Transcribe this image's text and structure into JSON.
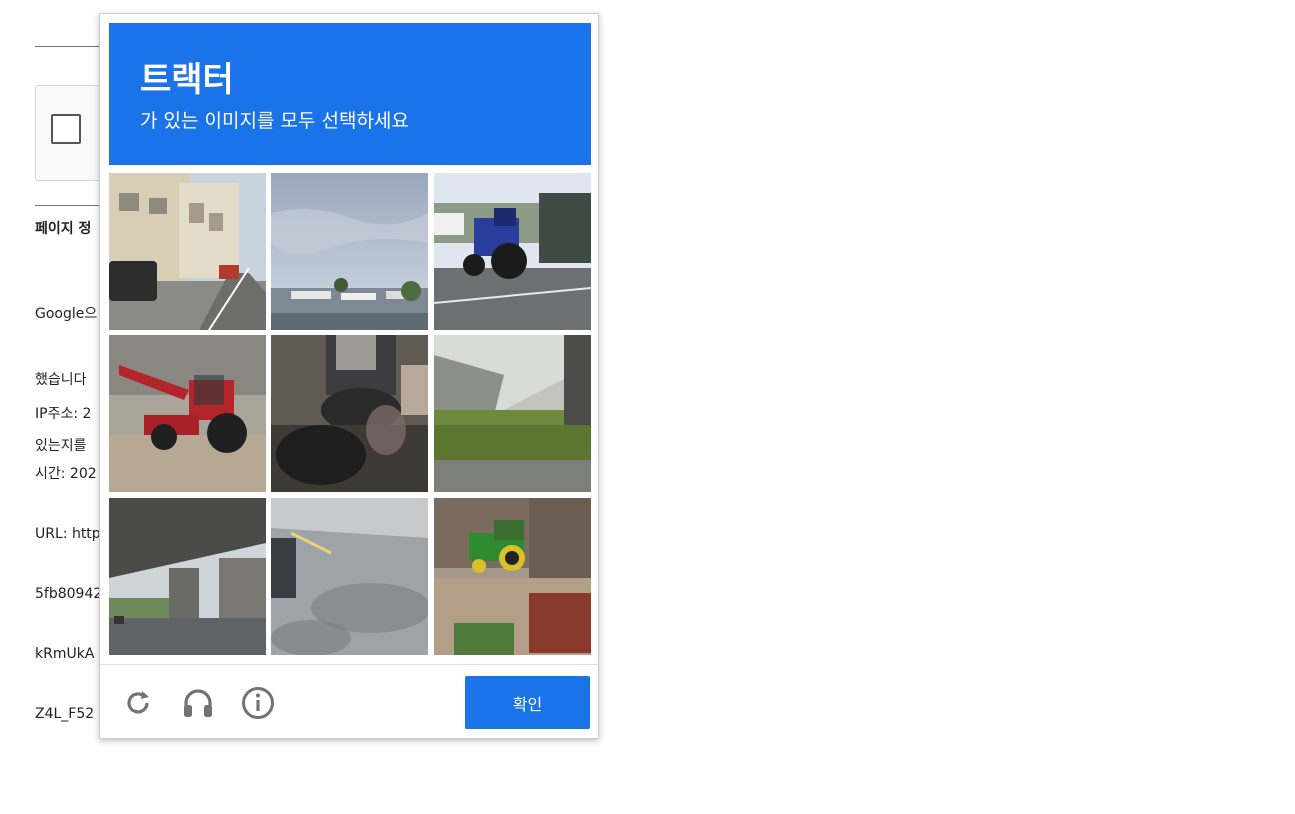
{
  "background_page": {
    "section_title": "페이지 정",
    "paragraph_lines": [
      "Google으",
      "했습니다",
      "있는지를"
    ],
    "info_lines": [
      "IP주소: 2",
      "시간: 202",
      "URL: http",
      "5fb80942",
      "kRmUkA",
      "Z4L_F52"
    ]
  },
  "challenge": {
    "keyword": "트랙터",
    "instruction": "가 있는 이미지를 모두 선택하세요",
    "tiles": [
      {
        "scene": "street with buildings and parked van",
        "selected": false
      },
      {
        "scene": "harbor under cloudy sky",
        "selected": false
      },
      {
        "scene": "blue tractor on road",
        "selected": false
      },
      {
        "scene": "red tractor with loader",
        "selected": false
      },
      {
        "scene": "person on motorcycle",
        "selected": false
      },
      {
        "scene": "grassy slope under overpass",
        "selected": false
      },
      {
        "scene": "highway overpass",
        "selected": false
      },
      {
        "scene": "asphalt road with shadows",
        "selected": false
      },
      {
        "scene": "green tractor near barn",
        "selected": false
      }
    ],
    "footer": {
      "icons": [
        "reload-icon",
        "headphones-icon",
        "info-icon"
      ],
      "verify_label": "확인"
    },
    "colors": {
      "accent": "#1a73e8",
      "icon_gray": "#737373"
    }
  }
}
